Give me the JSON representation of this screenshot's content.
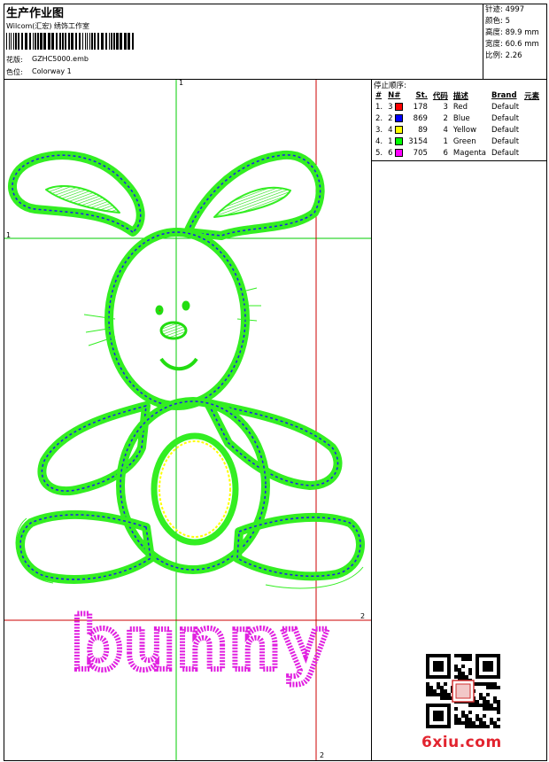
{
  "header": {
    "title": "生产作业图",
    "company": "Wilcom(汇宏) 绣饰工作室",
    "design_label": "花版:",
    "design_file": "GZHC5000.emb",
    "color_label": "色位:",
    "colorway": "Colorway 1"
  },
  "stats": [
    {
      "label": "针迹:",
      "value": "4997"
    },
    {
      "label": "颜色:",
      "value": "5"
    },
    {
      "label": "高度:",
      "value": "89.9 mm"
    },
    {
      "label": "宽度:",
      "value": "60.6 mm"
    },
    {
      "label": "比例:",
      "value": "2.26"
    }
  ],
  "stop_sequence": {
    "title": "停止顺序:",
    "headers": [
      "#",
      "N#",
      "St.",
      "代码",
      "描述",
      "Brand",
      "元素"
    ],
    "rows": [
      {
        "idx": "1.",
        "n": "3",
        "color": "#ff0000",
        "st": "178",
        "code": "3",
        "desc": "Red",
        "brand": "Default"
      },
      {
        "idx": "2.",
        "n": "2",
        "color": "#0000ff",
        "st": "869",
        "code": "2",
        "desc": "Blue",
        "brand": "Default"
      },
      {
        "idx": "3.",
        "n": "4",
        "color": "#ffff00",
        "st": "89",
        "code": "4",
        "desc": "Yellow",
        "brand": "Default"
      },
      {
        "idx": "4.",
        "n": "1",
        "color": "#00ff00",
        "st": "3154",
        "code": "1",
        "desc": "Green",
        "brand": "Default"
      },
      {
        "idx": "5.",
        "n": "6",
        "color": "#ff00ff",
        "st": "705",
        "code": "6",
        "desc": "Magenta",
        "brand": "Default"
      }
    ]
  },
  "design": {
    "text": "bunny",
    "axis_labels": {
      "top": "1",
      "left": "1",
      "right": "2",
      "bottom": "2"
    }
  },
  "watermark": "6xiu.com",
  "colors": {
    "green": "#33ee22",
    "blue": "#1a1aee",
    "magenta": "#e020e0",
    "yellow": "#ffff00",
    "guide_green": "#00cc00",
    "guide_red": "#cc0000"
  }
}
